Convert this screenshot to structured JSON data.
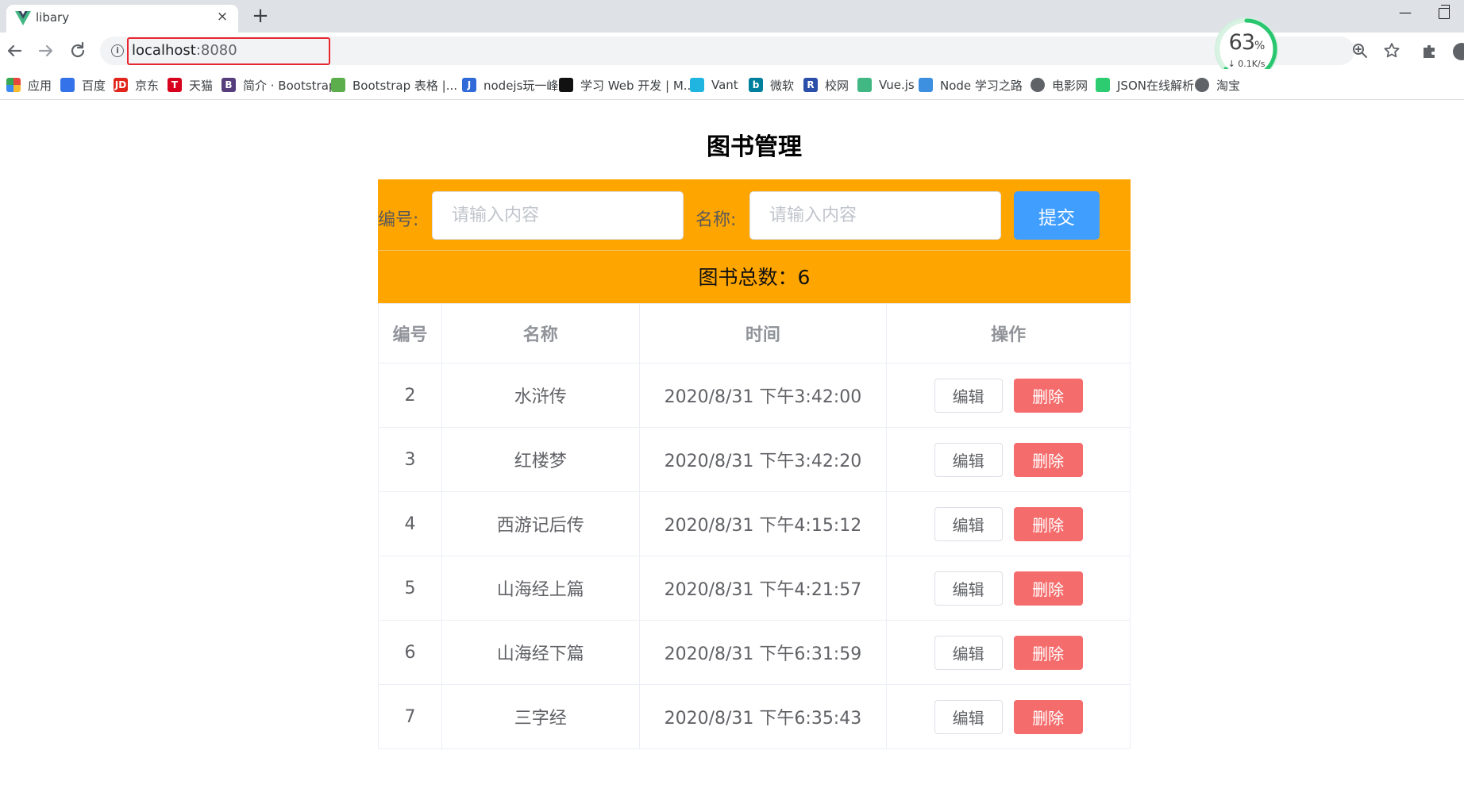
{
  "browser": {
    "tab_title": "libary",
    "tab_close": "×",
    "new_tab": "+",
    "url_host": "localhost",
    "url_port": ":8080",
    "speed_value": "63",
    "speed_unit": "%",
    "speed_rate": "↓ 0.1K/s"
  },
  "bookmarks": [
    {
      "label": "应用",
      "icon": "apps-grid-icon",
      "color": "#e8453c"
    },
    {
      "label": "百度",
      "icon": "baidu-paw-icon",
      "color": "#3372e8"
    },
    {
      "label": "京东",
      "icon": "jd-icon",
      "color": "#e1251b",
      "glyph": "JD"
    },
    {
      "label": "天猫",
      "icon": "tmall-icon",
      "color": "#d8001c",
      "glyph": "T"
    },
    {
      "label": "简介 · Bootstrap",
      "icon": "bootstrap-icon",
      "color": "#563d7c",
      "glyph": "B"
    },
    {
      "label": "Bootstrap 表格 |...",
      "icon": "globe-green-icon",
      "color": "#5cae4c"
    },
    {
      "label": "nodejs玩一峰",
      "icon": "j-icon",
      "color": "#2f6ad8",
      "glyph": "J"
    },
    {
      "label": "学习 Web 开发 | M...",
      "icon": "mdn-icon",
      "color": "#111111"
    },
    {
      "label": "Vant",
      "icon": "vant-icon",
      "color": "#1fb5e0"
    },
    {
      "label": "微软",
      "icon": "bing-icon",
      "color": "#00809d",
      "glyph": "b"
    },
    {
      "label": "校网",
      "icon": "r-icon",
      "color": "#2b4fa8",
      "glyph": "R"
    },
    {
      "label": "Vue.js",
      "icon": "vue-icon",
      "color": "#41b883"
    },
    {
      "label": "Node 学习之路",
      "icon": "cloud-icon",
      "color": "#3d8fe0"
    },
    {
      "label": "电影网",
      "icon": "globe-icon",
      "color": "#5f6368"
    },
    {
      "label": "JSON在线解析",
      "icon": "json-icon",
      "color": "#2ecc71"
    },
    {
      "label": "淘宝",
      "icon": "globe-icon",
      "color": "#5f6368"
    }
  ],
  "page": {
    "title": "图书管理",
    "form": {
      "id_label": "编号:",
      "id_placeholder": "请输入内容",
      "name_label": "名称:",
      "name_placeholder": "请输入内容",
      "submit_label": "提交"
    },
    "count_text": "图书总数：6",
    "table": {
      "headers": [
        "编号",
        "名称",
        "时间",
        "操作"
      ],
      "edit_label": "编辑",
      "delete_label": "删除",
      "rows": [
        {
          "id": "2",
          "name": "水浒传",
          "time": "2020/8/31 下午3:42:00"
        },
        {
          "id": "3",
          "name": "红楼梦",
          "time": "2020/8/31 下午3:42:20"
        },
        {
          "id": "4",
          "name": "西游记后传",
          "time": "2020/8/31 下午4:15:12"
        },
        {
          "id": "5",
          "name": "山海经上篇",
          "time": "2020/8/31 下午4:21:57"
        },
        {
          "id": "6",
          "name": "山海经下篇",
          "time": "2020/8/31 下午6:31:59"
        },
        {
          "id": "7",
          "name": "三字经",
          "time": "2020/8/31 下午6:35:43"
        }
      ]
    }
  },
  "colors": {
    "form_bar": "#ffa500",
    "submit": "#409eff",
    "delete": "#f56c6c",
    "url_highlight": "#e8272e"
  }
}
